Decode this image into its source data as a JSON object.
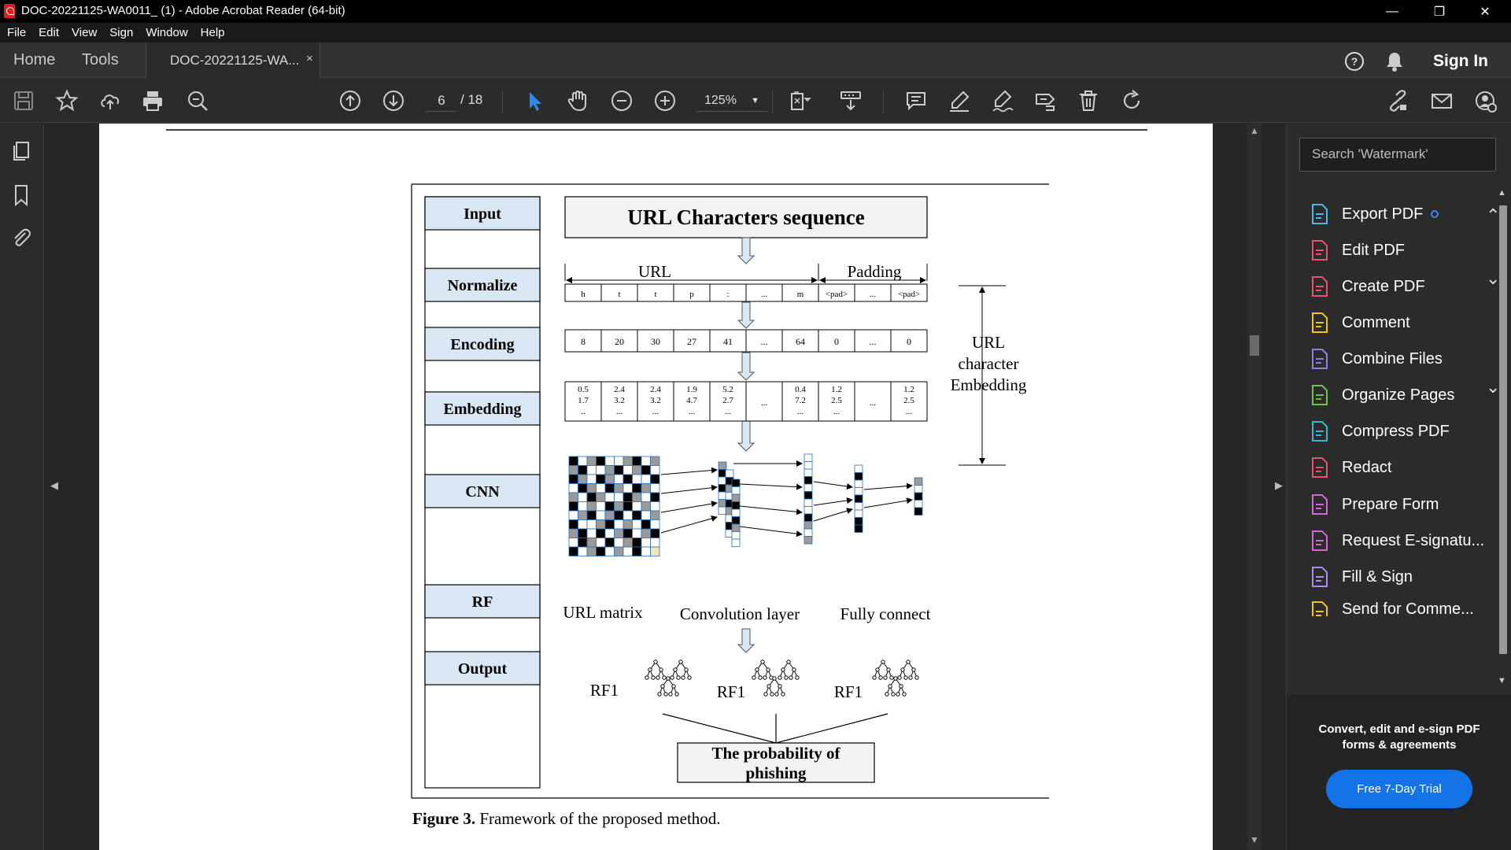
{
  "window": {
    "title": "DOC-20221125-WA0011_ (1) - Adobe Acrobat Reader (64-bit)",
    "minimize": "—",
    "restore": "❐",
    "close": "✕"
  },
  "menu": [
    "File",
    "Edit",
    "View",
    "Sign",
    "Window",
    "Help"
  ],
  "tabs": {
    "home": "Home",
    "tools": "Tools",
    "document": "DOC-20221125-WA...",
    "close": "×"
  },
  "account": {
    "sign_in": "Sign In"
  },
  "toolbar": {
    "page_current": "6",
    "page_total": "/ 18",
    "zoom": "125%"
  },
  "right_panel": {
    "search_placeholder": "Search 'Watermark'",
    "tools": [
      {
        "label": "Export PDF",
        "icon": "export-pdf-icon",
        "color": "#49b8e8",
        "chevron": "up"
      },
      {
        "label": "Edit PDF",
        "icon": "edit-pdf-icon",
        "color": "#e8526a",
        "chevron": ""
      },
      {
        "label": "Create PDF",
        "icon": "create-pdf-icon",
        "color": "#e8526a",
        "chevron": "down"
      },
      {
        "label": "Comment",
        "icon": "comment-icon",
        "color": "#f0c419",
        "chevron": ""
      },
      {
        "label": "Combine Files",
        "icon": "combine-files-icon",
        "color": "#8f7ee6",
        "chevron": ""
      },
      {
        "label": "Organize Pages",
        "icon": "organize-pages-icon",
        "color": "#6bc34a",
        "chevron": "down"
      },
      {
        "label": "Compress PDF",
        "icon": "compress-pdf-icon",
        "color": "#35b9c9",
        "chevron": ""
      },
      {
        "label": "Redact",
        "icon": "redact-icon",
        "color": "#e8526a",
        "chevron": ""
      },
      {
        "label": "Prepare Form",
        "icon": "prepare-form-icon",
        "color": "#d268d8",
        "chevron": ""
      },
      {
        "label": "Request E-signatu...",
        "icon": "request-esign-icon",
        "color": "#d268d8",
        "chevron": ""
      },
      {
        "label": "Fill & Sign",
        "icon": "fill-sign-icon",
        "color": "#a98cf0",
        "chevron": ""
      },
      {
        "label": "Send for Comme...",
        "icon": "send-comment-icon",
        "color": "#f0c419",
        "chevron": ""
      }
    ],
    "promo_text": "Convert, edit and e-sign PDF forms & agreements",
    "promo_button": "Free 7-Day Trial"
  },
  "figure": {
    "stages": [
      "Input",
      "Normalize",
      "Encoding",
      "Embedding",
      "CNN",
      "RF",
      "Output"
    ],
    "url_sequence_title": "URL Characters sequence",
    "url_label": "URL",
    "padding_label": "Padding",
    "normalize_cells": [
      "h",
      "t",
      "t",
      "p",
      ":",
      "...",
      "m",
      "<pad>",
      "...",
      "<pad>"
    ],
    "encoding_cells": [
      "8",
      "20",
      "30",
      "27",
      "41",
      "...",
      "64",
      "0",
      "...",
      "0"
    ],
    "embedding_cells": [
      [
        "0.5",
        "1.7",
        ".."
      ],
      [
        "2.4",
        "3.2",
        "..."
      ],
      [
        "2.4",
        "3.2",
        "..."
      ],
      [
        "1.9",
        "4.7",
        "..."
      ],
      [
        "5.2",
        "2.7",
        "..."
      ],
      [
        "",
        "...",
        ""
      ],
      [
        "0.4",
        "7.2",
        "..."
      ],
      [
        "1.2",
        "2.5",
        "..."
      ],
      [
        "",
        "...",
        ""
      ],
      [
        "1.2",
        "2.5",
        "..."
      ]
    ],
    "side_label": [
      "URL",
      "character",
      "Embedding"
    ],
    "url_matrix_label": "URL matrix",
    "conv_label": "Convolution layer",
    "fully_label": "Fully connect",
    "rf_labels": [
      "RF1",
      "RF1",
      "RF1"
    ],
    "output_text": [
      "The probability of",
      "phishing"
    ],
    "caption_bold": "Figure 3.",
    "caption_text": " Framework of the proposed method."
  }
}
